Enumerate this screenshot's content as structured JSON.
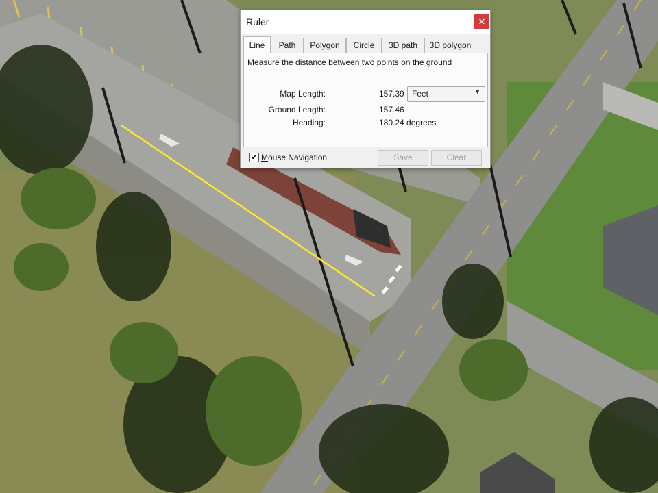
{
  "window": {
    "title": "Ruler",
    "close_glyph": "✕"
  },
  "tabs": [
    {
      "label": "Line",
      "active": true
    },
    {
      "label": "Path",
      "active": false
    },
    {
      "label": "Polygon",
      "active": false
    },
    {
      "label": "Circle",
      "active": false
    },
    {
      "label": "3D path",
      "active": false
    },
    {
      "label": "3D polygon",
      "active": false
    }
  ],
  "description": "Measure the distance between two points on the ground",
  "measurements": {
    "map_length_label": "Map Length:",
    "map_length_value": "157.39",
    "unit": "Feet",
    "ground_length_label": "Ground Length:",
    "ground_length_value": "157.46",
    "heading_label": "Heading:",
    "heading_value": "180.24 degrees"
  },
  "mouse_navigation": {
    "label_prefix": "M",
    "label_rest": "ouse Navigation",
    "checked": true,
    "check_glyph": "✔"
  },
  "buttons": {
    "save": "Save",
    "clear": "Clear",
    "save_enabled": false,
    "clear_enabled": false
  },
  "colors": {
    "measure_line": "#ffe92a",
    "close_button": "#d13d3d"
  }
}
